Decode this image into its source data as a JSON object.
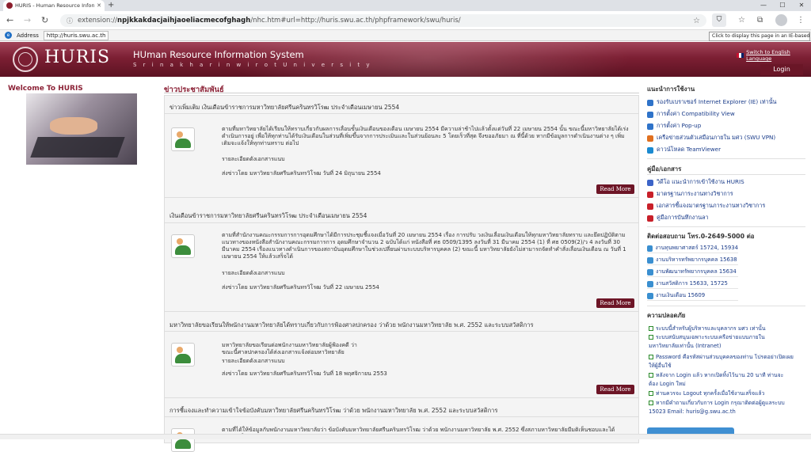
{
  "browser": {
    "tab_title": "HURIS - Human Resource Inform",
    "url_prefix": "extension://",
    "url_bold": "npjkkakdacjaihjaoeliacmecofghagh",
    "url_rest": "/nhc.htm#url=http://huris.swu.ac.th/phpframework/swu/huris/",
    "ie_address_label": "Address",
    "ie_address_value": "http://huris.swu.ac.th",
    "ie_tooltip": "Click to display this page in an IE-based tab"
  },
  "header": {
    "brand": "HURIS",
    "system_name": "HUman Resource Information System",
    "university": "S r i n a k h a r i n w i r o t   U n i v e r s i t y",
    "switch_language": "Switch to English Language",
    "login": "Login"
  },
  "left": {
    "welcome": "Welcome  To  HURIS"
  },
  "main": {
    "title": "ข่าวประชาสัมพันธ์",
    "read_more": "Read More",
    "items": [
      {
        "title": "ข่าวเพิ่มเติม เงินเดือนข้าราชการมหาวิทยาลัยศรีนครินทรวิโรฒ ประจำเดือนเมษายน 2554",
        "body": "ตามที่มหาวิทยาลัยได้เรียนให้ทราบเกี่ยวกับผลการเลื่อนขั้นเงินเดือนของเดือน เมษายน 2554 มีความล่าช้าไปแล้วตั้งแต่วันที่ 22 เมษายน 2554 นั้น ขณะนี้มหาวิทยาลัยได้เร่งดำเนินการอยู่ เพื่อให้ทุกท่านได้รับเงินเดือนในส่วนที่เพิ่มขึ้นจากการประเมินและในส่วนย้อนละ 5 โดยเร็วที่สุด จึงขออภัยมา ณ ที่นี้ด้วย หากมีข้อมูลการดำเนินงานต่าง ๆ เพิ่มเติมจะแจ้งให้ทุกท่านทราบ ต่อไป",
        "attach": "รายละเอียดดังเอกสารแนบ",
        "posted": "ส่งข่าวโดย มหาวิทยาลัยศรีนครินทรวิโรฒ วันที่ 24 มิถุนายน 2554"
      },
      {
        "title": "เงินเดือนข้าราชการมหาวิทยาลัยศรีนครินทรวิโรฒ ประจำเดือนเมษายน 2554",
        "body": "ตามที่สำนักงานคณะกรรมการการอุดมศึกษาได้มีการประชุมชี้แจงเมื่อวันที่ 20 เมษายน 2554 เรื่อง การปรับ วงเงินเลื่อนเงินเดือนให้ทุกมหาวิทยาลัยทราบ และยึดปฏิบัติตามแนวทางของหนังสือสำนักงานคณะกรรมการการ อุดมศึกษาจำนวน 2 ฉบับได้แก่ หนังสือที่ ศธ 0509/1395 ลงวันที่ 31 มีนาคม 2554 (1) ที่ ศธ 0509(2)/ว 4 ลงวันที่ 30 มีนาคม 2554 เรื่องแนวทางดำเนินการของสถาบันอุดมศึกษาในช่วงเปลี่ยนผ่านระบบบริหารบุคคล (2) ขณะนี้ มหาวิทยาลัยยังไม่สามารถจัดทำคำสั่งเลื่อนเงินเดือน ณ วันที่ 1 เมษายน 2554 ให้แล้วเสร็จได้",
        "attach": "รายละเอียดดังเอกสารแนบ",
        "posted": "ส่งข่าวโดย มหาวิทยาลัยศรีนครินทรวิโรฒ วันที่ 22 เมษายน 2554"
      },
      {
        "title": "มหาวิทยาลัยขอเรียนให้พนักงานมหาวิทยาลัยได้ทราบเกี่ยวกับการฟ้องศาลปกครอง ว่าด้วย พนักงานมหาวิทยาลัย พ.ศ. 2552 และระบบสวัสดิการ",
        "body": "มหาวิทยาลัยขอเรียนต่อพนักงานมหาวิทยาลัยผู้ฟ้องคดี ว่าขณะนี้ศาลปกครองได้ส่งเอกสารแจ้งต่อมหาวิทยาลัย",
        "attach": "รายละเอียดดังเอกสารแนบ",
        "posted": "ส่งข่าวโดย มหาวิทยาลัยศรีนครินทรวิโรฒ วันที่ 18 พฤศจิกายน 2553"
      },
      {
        "title": "การชี้แจงและทำความเข้าใจข้อบังคับมหาวิทยาลัยศรีนครินทรวิโรฒ ว่าด้วย พนักงานมหาวิทยาลัย พ.ศ. 2552 และระบบสวัสดิการ",
        "body": "ตามที่ได้ให้ข้อมูลกับพนักงานมหาวิทยาลัยว่า ข้อบังคับมหาวิทยาลัยศรีนครินทรวิโรฒ ว่าด้วย พนักงานมหาวิทยาลัย พ.ศ. 2552 ซึ่งสภามหาวิทยาลัยมีมติเห็นชอบและได้ประกาศใช้"
      }
    ]
  },
  "right": {
    "guide_title": "แนะนำการใช้งาน",
    "guide": [
      {
        "label": "รองรับเบราเซอร์ Internet Explorer (IE) เท่านั้น",
        "color": "#2f73c9"
      },
      {
        "label": "การตั้งค่า Compatibility View",
        "color": "#2f73c9"
      },
      {
        "label": "การตั้งค่า Pop-up",
        "color": "#2f73c9"
      },
      {
        "label": "เครือข่ายส่วนตัวเสมือนภายใน มศว (SWU VPN)",
        "color": "#e07020"
      },
      {
        "label": "ดาวน์โหลด TeamViewer",
        "color": "#1b8ad0"
      }
    ],
    "manual_title": "คู่มือ/เอกสาร",
    "manuals": [
      {
        "label": "วิดีโอ แนะนำการเข้าใช้งาน HURIS",
        "color": "#3c64c8"
      },
      {
        "label": "มาตรฐานภาระงานทางวิชาการ",
        "color": "#c8202a"
      },
      {
        "label": "เอกสารชี้แจงมาตรฐานภาระงานทางวิชาการ",
        "color": "#c8202a"
      },
      {
        "label": "คู่มือการบันทึกงานลา",
        "color": "#c8202a"
      }
    ],
    "contact_title": "ติดต่อสอบถาม โทร.0-2649-5000 ต่อ",
    "contacts": [
      "งานทุนพยาศาสตร์ 15724, 15934",
      "งานบริหารทรัพยากรบุคคล 15638",
      "งานพัฒนาทรัพยากรบุคคล 15634",
      "งานสวัสดิการ 15633, 15725",
      "งานเงินเดือน 15609"
    ],
    "security_title": "ความปลอดภัย",
    "security": [
      "ระบบนี้สำหรับผู้บริหารและบุคลากร มศว เท่านั้น",
      "ระบบสนับสนุนเฉพาะระบบเครือข่ายแบบภายใน",
      "มหาวิทยาลัยเท่านั้น (Intranet)",
      "Password คือรหัสผ่านส่วนบุคคลของท่าน โปรดอย่าเปิดเผย",
      "ให้ผู้อื่นใช้",
      "หลังจาก Login แล้ว หากเปิดทิ้งไว้นาน 20 นาที ท่านจะ",
      "ต้อง Login ใหม่",
      "ท่านควรจะ Logout ทุกครั้งเมื่อใช้งานเสร็จแล้ว",
      "หากมีคำถามเกี่ยวกับการ Login กรุณาติดต่อผู้ดูแลระบบ",
      "15023 Email: huris@g.swu.ac.th"
    ]
  }
}
